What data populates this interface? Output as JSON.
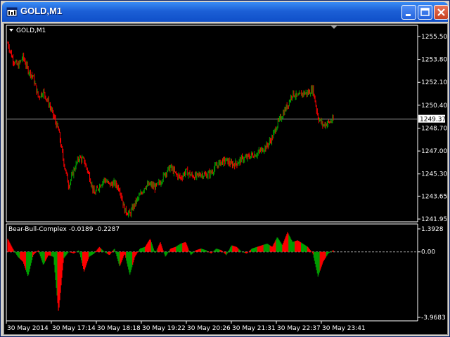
{
  "window": {
    "title": "GOLD,M1"
  },
  "main_panel": {
    "symbol_label": "GOLD,M1",
    "price_ticks": [
      "1255.50",
      "1253.80",
      "1252.10",
      "1250.40",
      "1248.70",
      "1247.00",
      "1245.30",
      "1243.65",
      "1241.95"
    ],
    "current_price": "1249.37"
  },
  "indicator_panel": {
    "label": "Bear-Bull-Complex -0.0189 -0.2287",
    "ticks": [
      "1.3928",
      "0.00",
      "-3.9683"
    ]
  },
  "time_axis": {
    "labels": [
      "30 May 2014",
      "30 May 17:14",
      "30 May 18:18",
      "30 May 19:22",
      "30 May 20:26",
      "30 May 21:31",
      "30 May 22:37",
      "30 May 23:41"
    ]
  },
  "colors": {
    "bull": "#00a000",
    "bear": "#ff0000",
    "background": "#000000",
    "grid_text": "#ffffff",
    "price_line": "#a0a0a0"
  },
  "chart_data": [
    {
      "type": "candlestick",
      "title": "GOLD,M1",
      "ylim": [
        1241.95,
        1255.5
      ],
      "x_ticks": [
        "30 May 2014",
        "30 May 17:14",
        "30 May 18:18",
        "30 May 19:22",
        "30 May 20:26",
        "30 May 21:31",
        "30 May 22:37",
        "30 May 23:41"
      ],
      "close_path": [
        1255.0,
        1253.8,
        1253.3,
        1254.0,
        1253.0,
        1252.5,
        1251.0,
        1251.4,
        1250.6,
        1249.6,
        1248.5,
        1246.2,
        1244.4,
        1245.6,
        1246.5,
        1246.3,
        1245.2,
        1243.8,
        1244.4,
        1244.9,
        1244.5,
        1244.6,
        1244.2,
        1242.6,
        1242.3,
        1243.1,
        1243.7,
        1244.4,
        1244.5,
        1244.3,
        1244.7,
        1245.4,
        1245.8,
        1245.3,
        1245.0,
        1245.5,
        1245.2,
        1245.1,
        1245.3,
        1245.2,
        1245.4,
        1245.9,
        1246.2,
        1246.3,
        1246.0,
        1246.1,
        1246.4,
        1246.5,
        1246.7,
        1246.8,
        1247.1,
        1247.4,
        1248.0,
        1249.0,
        1249.7,
        1250.4,
        1251.3,
        1251.0,
        1251.3,
        1251.3,
        1251.6,
        1249.5,
        1248.9,
        1249.1,
        1249.3
      ],
      "current_price": 1249.37
    },
    {
      "type": "area",
      "title": "Bear-Bull-Complex -0.0189 -0.2287",
      "ylim": [
        -3.9683,
        1.3928
      ],
      "values": [
        0.8,
        0.2,
        -0.3,
        -0.6,
        -1.5,
        -0.2,
        0.1,
        -0.8,
        -0.2,
        -0.3,
        -3.7,
        -0.4,
        0.0,
        -0.1,
        0.1,
        -1.2,
        -0.3,
        -0.1,
        0.3,
        0.0,
        -0.2,
        0.2,
        -0.9,
        -0.1,
        -1.4,
        -0.3,
        0.2,
        0.3,
        0.8,
        -0.1,
        0.6,
        -0.3,
        0.2,
        0.3,
        0.5,
        0.6,
        -0.2,
        0.1,
        0.2,
        0.1,
        -0.1,
        0.2,
        0.1,
        -0.2,
        0.4,
        0.3,
        0.0,
        -0.1,
        0.2,
        0.3,
        0.4,
        0.5,
        0.3,
        0.9,
        0.4,
        1.2,
        0.6,
        0.7,
        0.5,
        0.3,
        -0.1,
        -1.5,
        -0.6,
        -0.1,
        0.1
      ]
    }
  ]
}
